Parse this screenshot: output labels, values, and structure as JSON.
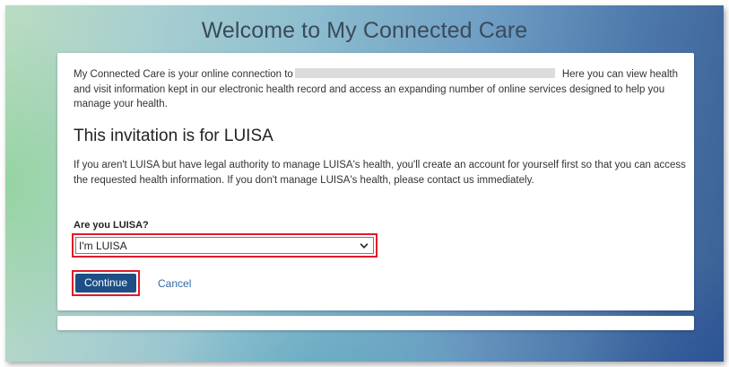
{
  "page": {
    "title": "Welcome to My Connected Care"
  },
  "intro": {
    "text_before": "My Connected Care is your online connection to",
    "text_after": "Here you can view health and visit information kept in our electronic health record and access an expanding number of online services designed to help you manage your health."
  },
  "invitation": {
    "heading": "This invitation is for LUISA",
    "explanation": "If you aren't LUISA but have legal authority to manage LUISA's health, you'll create an account for yourself first so that you can access the requested health information. If you don't manage LUISA's health, please contact us immediately."
  },
  "form": {
    "question": "Are you LUISA?",
    "selected_option": "I'm LUISA",
    "continue_label": "Continue",
    "cancel_label": "Cancel"
  },
  "colors": {
    "primary_button": "#1d4f86",
    "highlight": "#e01b2a",
    "link": "#2f6aa8"
  },
  "icons": {
    "select_chevron": "chevron-down-icon"
  }
}
